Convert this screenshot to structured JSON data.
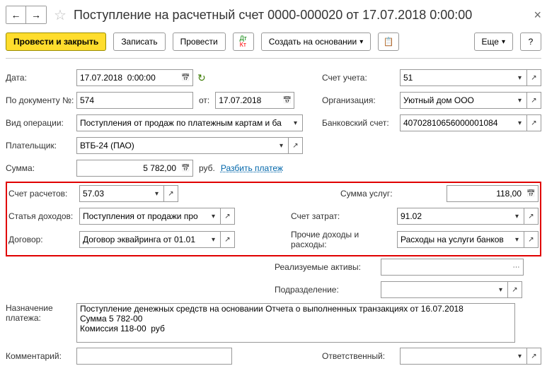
{
  "window": {
    "title": "Поступление на расчетный счет 0000-000020 от 17.07.2018 0:00:00",
    "alert_icon": "↻"
  },
  "toolbar": {
    "post_close": "Провести и закрыть",
    "write": "Записать",
    "post": "Провести",
    "create_based": "Создать на основании",
    "more": "Еще",
    "help": "?"
  },
  "labels": {
    "date": "Дата:",
    "account": "Счет учета:",
    "doc_num": "По документу №:",
    "from": "от:",
    "org": "Организация:",
    "op_type": "Вид операции:",
    "bank_acc": "Банковский счет:",
    "payer": "Плательщик:",
    "amount": "Сумма:",
    "rub": "руб.",
    "split": "Разбить платеж",
    "calc_acct": "Счет расчетов:",
    "serv_amount": "Сумма услуг:",
    "income_art": "Статья доходов:",
    "cost_acct": "Счет затрат:",
    "contract": "Договор:",
    "other": "Прочие доходы и расходы:",
    "assets": "Реализуемые активы:",
    "dept": "Подразделение:",
    "purpose": "Назначение платежа:",
    "comment": "Комментарий:",
    "responsible": "Ответственный:"
  },
  "values": {
    "date": "17.07.2018  0:00:00",
    "account": "51",
    "doc_num": "574",
    "doc_date": "17.07.2018",
    "org": "Уютный дом ООО",
    "op_type": "Поступления от продаж по платежным картам и ба",
    "bank_acc": "40702810656000001084",
    "payer": "ВТБ-24 (ПАО)",
    "amount": "5 782,00",
    "calc_acct": "57.03",
    "serv_amount": "118,00",
    "income_art": "Поступления от продажи про",
    "cost_acct": "91.02",
    "contract": "Договор эквайринга от 01.01",
    "other": "Расходы на услуги банков",
    "assets": "",
    "dept": "",
    "purpose": "Поступление денежных средств на основании Отчета о выполненных транзакциях от 16.07.2018\nСумма 5 782-00\nКомиссия 118-00  руб",
    "comment": "",
    "responsible": ""
  }
}
